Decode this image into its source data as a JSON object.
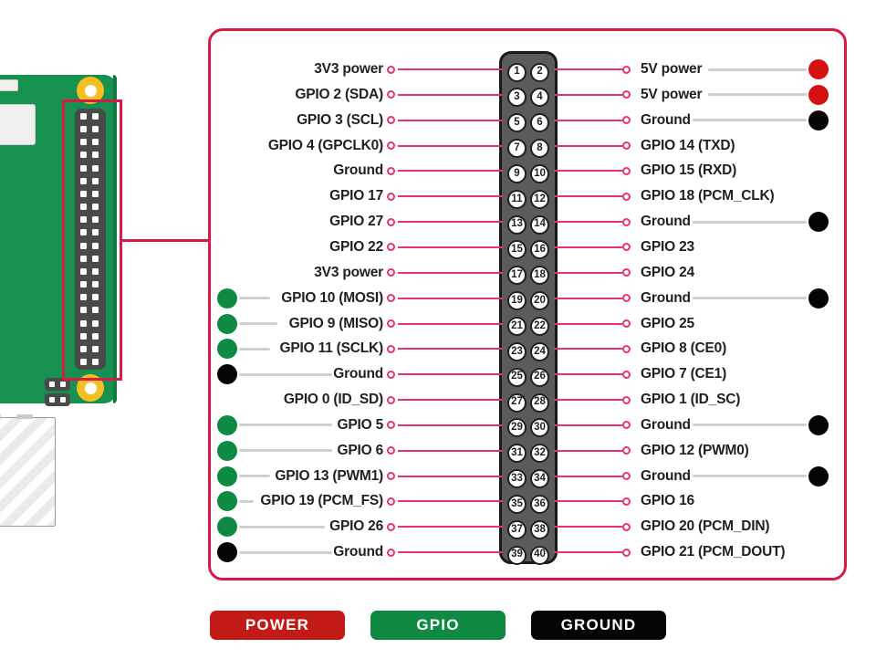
{
  "diagram": {
    "title": "Raspberry Pi 40-pin GPIO header pinout",
    "colors": {
      "power": "#d41212",
      "gpio": "#0e8a43",
      "ground": "#050505",
      "frame": "#d81b45",
      "connector_line": "#e8336d",
      "stem": "#cfcfcf",
      "pcb": "#16914f",
      "header_block": "#5b5b5b"
    }
  },
  "board": {
    "name": "raspberry-pi-board",
    "highlight": "gpio-header-highlight"
  },
  "rows": [
    {
      "left_label": "3V3 power",
      "left_type": "none",
      "left_pin": 1,
      "right_pin": 2,
      "right_label": "5V power",
      "right_type": "power"
    },
    {
      "left_label": "GPIO 2 (SDA)",
      "left_type": "none",
      "left_pin": 3,
      "right_pin": 4,
      "right_label": "5V power",
      "right_type": "power"
    },
    {
      "left_label": "GPIO 3 (SCL)",
      "left_type": "none",
      "left_pin": 5,
      "right_pin": 6,
      "right_label": "Ground",
      "right_type": "ground"
    },
    {
      "left_label": "GPIO 4 (GPCLK0)",
      "left_type": "none",
      "left_pin": 7,
      "right_pin": 8,
      "right_label": "GPIO 14 (TXD)",
      "right_type": "none"
    },
    {
      "left_label": "Ground",
      "left_type": "none",
      "left_pin": 9,
      "right_pin": 10,
      "right_label": "GPIO 15 (RXD)",
      "right_type": "none"
    },
    {
      "left_label": "GPIO 17",
      "left_type": "none",
      "left_pin": 11,
      "right_pin": 12,
      "right_label": "GPIO 18 (PCM_CLK)",
      "right_type": "none"
    },
    {
      "left_label": "GPIO 27",
      "left_type": "none",
      "left_pin": 13,
      "right_pin": 14,
      "right_label": "Ground",
      "right_type": "ground"
    },
    {
      "left_label": "GPIO 22",
      "left_type": "none",
      "left_pin": 15,
      "right_pin": 16,
      "right_label": "GPIO 23",
      "right_type": "none"
    },
    {
      "left_label": "3V3 power",
      "left_type": "none",
      "left_pin": 17,
      "right_pin": 18,
      "right_label": "GPIO 24",
      "right_type": "none"
    },
    {
      "left_label": "GPIO 10 (MOSI)",
      "left_type": "gpio",
      "left_pin": 19,
      "right_pin": 20,
      "right_label": "Ground",
      "right_type": "ground"
    },
    {
      "left_label": "GPIO 9 (MISO)",
      "left_type": "gpio",
      "left_pin": 21,
      "right_pin": 22,
      "right_label": "GPIO 25",
      "right_type": "none"
    },
    {
      "left_label": "GPIO 11 (SCLK)",
      "left_type": "gpio",
      "left_pin": 23,
      "right_pin": 24,
      "right_label": "GPIO 8 (CE0)",
      "right_type": "none"
    },
    {
      "left_label": "Ground",
      "left_type": "ground",
      "left_pin": 25,
      "right_pin": 26,
      "right_label": "GPIO 7 (CE1)",
      "right_type": "none"
    },
    {
      "left_label": "GPIO 0 (ID_SD)",
      "left_type": "none",
      "left_pin": 27,
      "right_pin": 28,
      "right_label": "GPIO 1 (ID_SC)",
      "right_type": "none"
    },
    {
      "left_label": "GPIO 5",
      "left_type": "gpio",
      "left_pin": 29,
      "right_pin": 30,
      "right_label": "Ground",
      "right_type": "ground"
    },
    {
      "left_label": "GPIO 6",
      "left_type": "gpio",
      "left_pin": 31,
      "right_pin": 32,
      "right_label": "GPIO 12 (PWM0)",
      "right_type": "none"
    },
    {
      "left_label": "GPIO 13 (PWM1)",
      "left_type": "gpio",
      "left_pin": 33,
      "right_pin": 34,
      "right_label": "Ground",
      "right_type": "ground"
    },
    {
      "left_label": "GPIO 19 (PCM_FS)",
      "left_type": "gpio",
      "left_pin": 35,
      "right_pin": 36,
      "right_label": "GPIO 16",
      "right_type": "none"
    },
    {
      "left_label": "GPIO 26",
      "left_type": "gpio",
      "left_pin": 37,
      "right_pin": 38,
      "right_label": "GPIO 20 (PCM_DIN)",
      "right_type": "none"
    },
    {
      "left_label": "Ground",
      "left_type": "ground",
      "left_pin": 39,
      "right_pin": 40,
      "right_label": "GPIO 21 (PCM_DOUT)",
      "right_type": "none"
    }
  ],
  "legend": [
    {
      "label": "POWER",
      "color": "#c21b17"
    },
    {
      "label": "GPIO",
      "color": "#0e8a43"
    },
    {
      "label": "GROUND",
      "color": "#050505"
    }
  ]
}
